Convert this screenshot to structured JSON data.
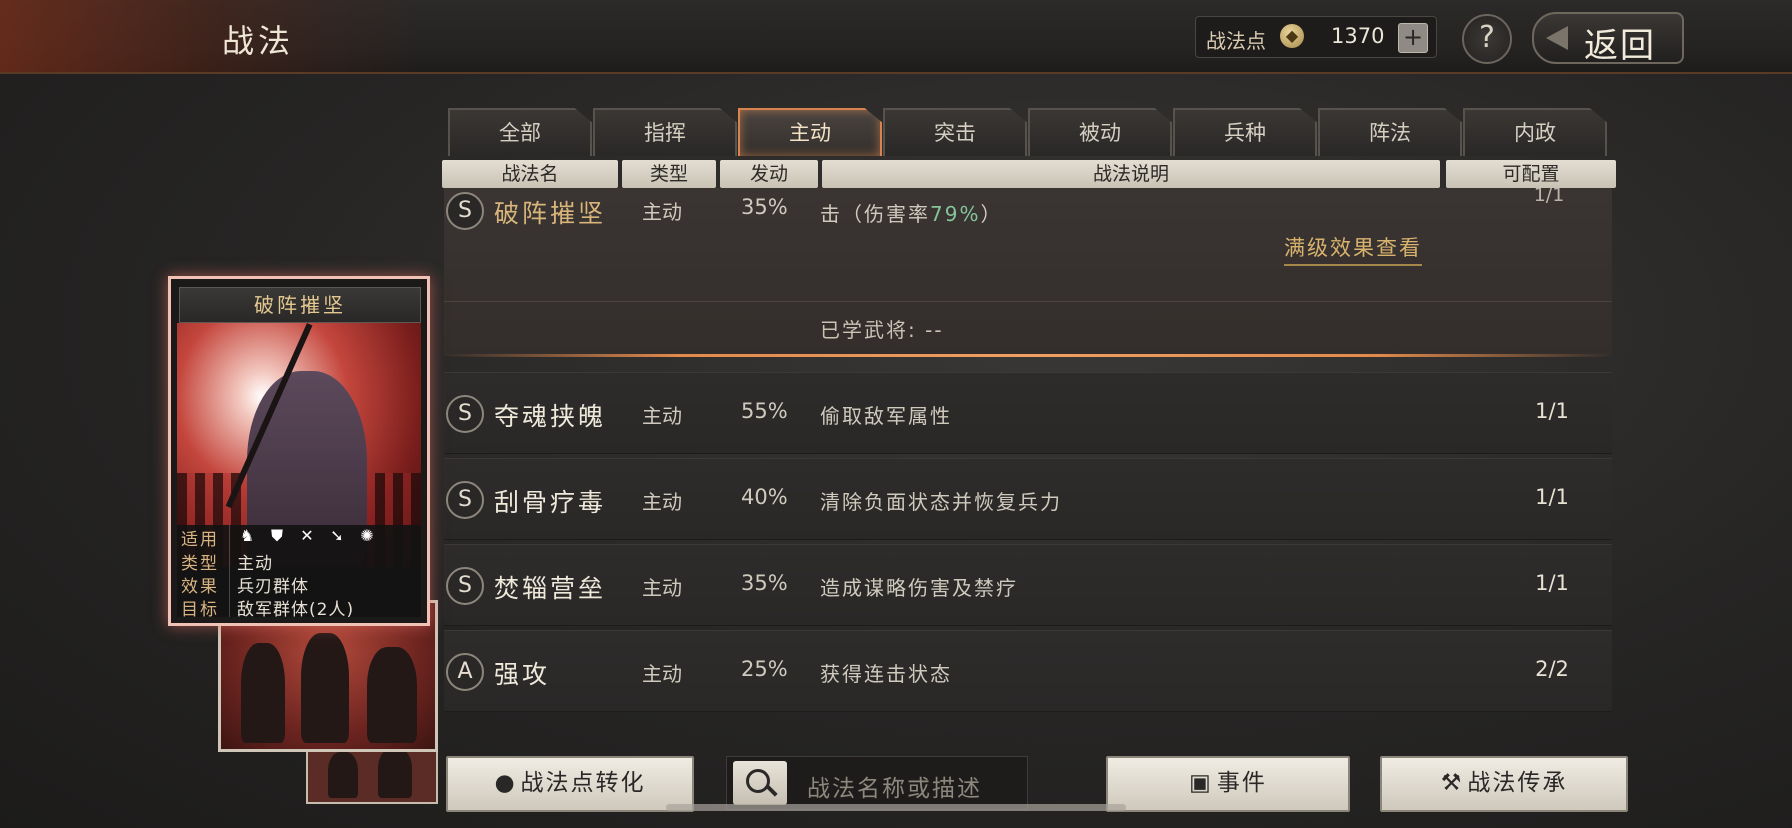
{
  "header": {
    "title": "战法",
    "points_label": "战法点",
    "points_value": "1370",
    "add_symbol": "+",
    "help_symbol": "?",
    "back_label": "返回"
  },
  "tabs": [
    {
      "label": "全部",
      "active": false
    },
    {
      "label": "指挥",
      "active": false
    },
    {
      "label": "主动",
      "active": true
    },
    {
      "label": "突击",
      "active": false
    },
    {
      "label": "被动",
      "active": false
    },
    {
      "label": "兵种",
      "active": false
    },
    {
      "label": "阵法",
      "active": false
    },
    {
      "label": "内政",
      "active": false
    }
  ],
  "columns": {
    "name": "战法名",
    "type": "类型",
    "rate": "发动",
    "desc": "战法说明",
    "config": "可配置"
  },
  "expanded": {
    "grade": "S",
    "name": "破阵摧坚",
    "type": "主动",
    "rate": "35%",
    "desc_prefix": "击（伤害率",
    "desc_highlight": "79%",
    "desc_suffix": "）",
    "config_partial": "1/1",
    "full_effect_link": "满级效果查看",
    "learned_label": "已学武将:",
    "learned_value": "--"
  },
  "rows": [
    {
      "grade": "S",
      "name": "夺魂挟魄",
      "type": "主动",
      "rate": "55%",
      "desc": "偷取敌军属性",
      "config": "1/1"
    },
    {
      "grade": "S",
      "name": "刮骨疗毒",
      "type": "主动",
      "rate": "40%",
      "desc": "清除负面状态并恢复兵力",
      "config": "1/1"
    },
    {
      "grade": "S",
      "name": "焚辎营垒",
      "type": "主动",
      "rate": "35%",
      "desc": "造成谋略伤害及禁疗",
      "config": "1/1"
    },
    {
      "grade": "A",
      "name": "强攻",
      "type": "主动",
      "rate": "25%",
      "desc": "获得连击状态",
      "config": "2/2"
    }
  ],
  "card": {
    "title": "破阵摧坚",
    "applicable_label": "适用",
    "applicable_icons": [
      "cavalry-icon",
      "shield-icon",
      "bow-icon",
      "spear-icon",
      "wheel-icon"
    ],
    "type_label": "类型",
    "type_value": "主动",
    "effect_label": "效果",
    "effect_value": "兵刃群体",
    "target_label": "目标",
    "target_value": "敌军群体(2人)"
  },
  "bottom": {
    "convert_label": "战法点转化",
    "search_placeholder": "战法名称或描述",
    "events_label": "事件",
    "inherit_label": "战法传承"
  },
  "colors": {
    "accent_orange": "#e18a4c",
    "gold_text": "#d8b36e",
    "highlight_green": "#85c49a"
  }
}
